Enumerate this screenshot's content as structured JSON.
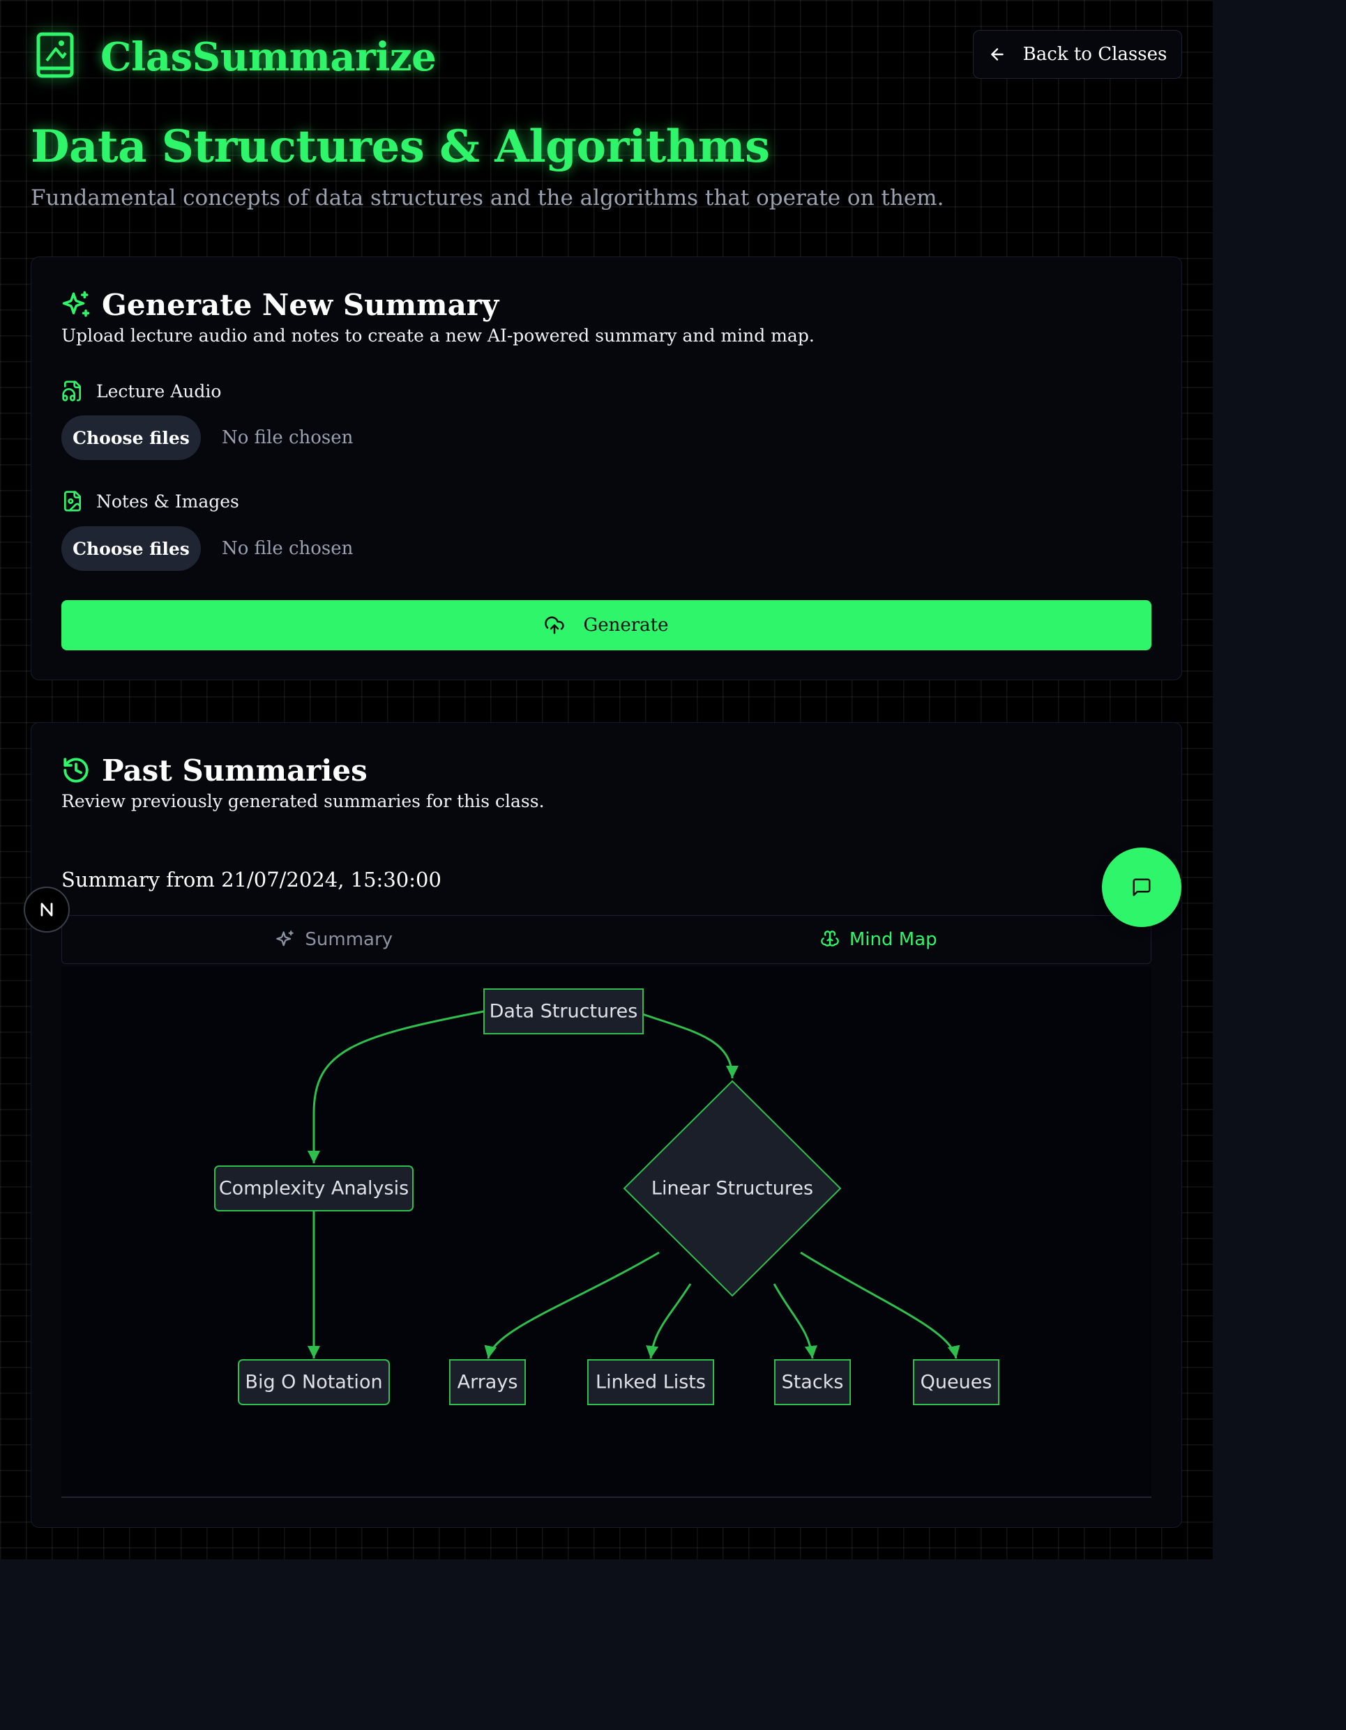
{
  "header": {
    "app_name": "ClasSummarize",
    "back_label": "Back to Classes",
    "icons": {
      "logo": "book-image-icon",
      "back": "arrow-left-icon"
    }
  },
  "class": {
    "title": "Data Structures & Algorithms",
    "description": "Fundamental concepts of data structures and the algorithms that operate on them."
  },
  "generate": {
    "title": "Generate New Summary",
    "description": "Upload lecture audio and notes to create a new AI-powered summary and mind map.",
    "audio": {
      "label": "Lecture Audio",
      "button": "Choose files",
      "status": "No file chosen"
    },
    "notes": {
      "label": "Notes & Images",
      "button": "Choose files",
      "status": "No file chosen"
    },
    "button": "Generate",
    "icons": {
      "title": "sparkles-icon",
      "audio": "file-audio-icon",
      "notes": "file-image-icon",
      "button": "upload-cloud-icon"
    }
  },
  "past": {
    "title": "Past Summaries",
    "description": "Review previously generated summaries for this class.",
    "summary_date": "Summary from 21/07/2024, 15:30:00",
    "tabs": [
      {
        "label": "Summary",
        "icon": "sparkles-icon",
        "active": false
      },
      {
        "label": "Mind Map",
        "icon": "brain-icon",
        "active": true
      }
    ],
    "icons": {
      "title": "history-icon"
    }
  },
  "mindmap": {
    "nodes": [
      {
        "id": "ds",
        "label": "Data Structures",
        "shape": "rect"
      },
      {
        "id": "ca",
        "label": "Complexity Analysis",
        "shape": "rounded"
      },
      {
        "id": "ls",
        "label": "Linear Structures",
        "shape": "diamond"
      },
      {
        "id": "bo",
        "label": "Big O Notation",
        "shape": "rounded"
      },
      {
        "id": "ar",
        "label": "Arrays",
        "shape": "rect"
      },
      {
        "id": "ll",
        "label": "Linked Lists",
        "shape": "rect"
      },
      {
        "id": "st",
        "label": "Stacks",
        "shape": "rect"
      },
      {
        "id": "qu",
        "label": "Queues",
        "shape": "rect"
      }
    ],
    "edges": [
      [
        "ds",
        "ca"
      ],
      [
        "ds",
        "ls"
      ],
      [
        "ca",
        "bo"
      ],
      [
        "ls",
        "ar"
      ],
      [
        "ls",
        "ll"
      ],
      [
        "ls",
        "st"
      ],
      [
        "ls",
        "qu"
      ]
    ]
  },
  "colors": {
    "accent": "#2ef569",
    "background": "#000000",
    "card": "#05070d",
    "node_fill": "#1b1f29",
    "node_stroke": "#2fbf4d"
  },
  "fab": {
    "icon": "message-square-icon"
  },
  "badge": {
    "icon": "n-letter-icon"
  }
}
